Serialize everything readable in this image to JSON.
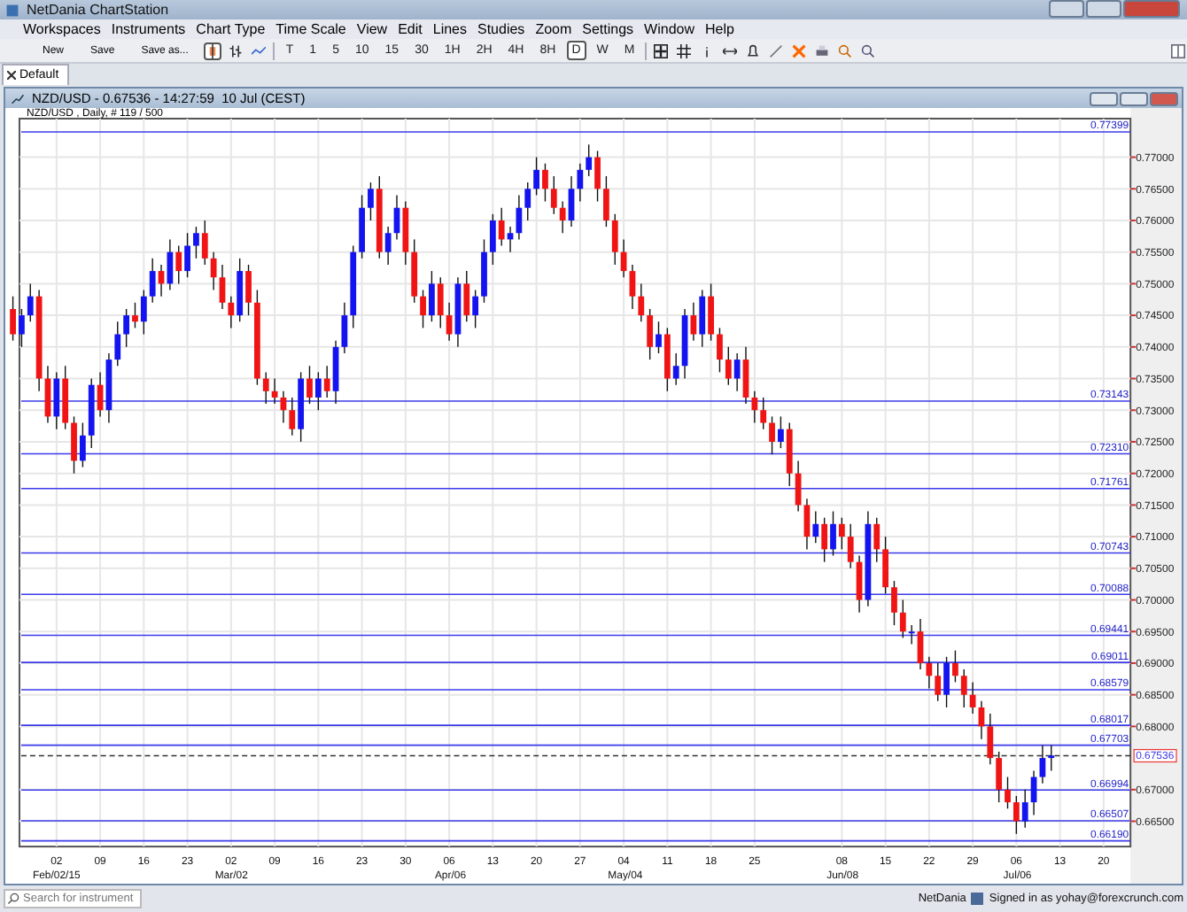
{
  "window": {
    "title": "NetDania ChartStation"
  },
  "menu": [
    "Workspaces",
    "Instruments",
    "Chart Type",
    "Time Scale",
    "View",
    "Edit",
    "Lines",
    "Studies",
    "Zoom",
    "Settings",
    "Window",
    "Help"
  ],
  "toolbar": {
    "file_buttons": [
      "New",
      "Save",
      "Save as..."
    ],
    "chart_types": [
      {
        "kind": "candle",
        "selected": true
      },
      {
        "kind": "bar",
        "selected": false
      },
      {
        "kind": "line",
        "selected": false
      }
    ],
    "timeframes": [
      {
        "label": "T",
        "selected": false
      },
      {
        "label": "1",
        "selected": false
      },
      {
        "label": "5",
        "selected": false
      },
      {
        "label": "10",
        "selected": false
      },
      {
        "label": "15",
        "selected": false
      },
      {
        "label": "30",
        "selected": false
      },
      {
        "label": "1H",
        "selected": false
      },
      {
        "label": "2H",
        "selected": false
      },
      {
        "label": "4H",
        "selected": false
      },
      {
        "label": "8H",
        "selected": false
      },
      {
        "label": "D",
        "selected": true
      },
      {
        "label": "W",
        "selected": false
      },
      {
        "label": "M",
        "selected": false
      }
    ]
  },
  "tabs": [
    {
      "label": "Default",
      "selected": true
    }
  ],
  "chart_window": {
    "title": "NZD/USD - 0.67536 - 14:27:59  10 Jul (CEST)",
    "subtitle": "NZD/USD , Daily, # 119 / 500",
    "price_lines": [
      {
        "label": "0.77399"
      },
      {
        "label": "0.73143"
      },
      {
        "label": "0.72310"
      },
      {
        "label": "0.71761"
      },
      {
        "label": "0.70743"
      },
      {
        "label": "0.70088"
      },
      {
        "label": "0.69441"
      },
      {
        "label": "0.69011"
      },
      {
        "label": "0.68579"
      },
      {
        "label": "0.68017"
      },
      {
        "label": "0.67703"
      },
      {
        "label": "0.66994"
      },
      {
        "label": "0.66507"
      },
      {
        "label": "0.66190"
      }
    ],
    "x_axis_months": [
      "Feb/02/15",
      "Mar/02",
      "Apr/06",
      "May/04",
      "Jun/08",
      "Jul/06"
    ],
    "chart_data": {
      "type": "candlestick",
      "categories": [
        null,
        null,
        null,
        null,
        null,
        "02",
        null,
        null,
        null,
        null,
        "09",
        null,
        null,
        null,
        null,
        "16",
        null,
        null,
        null,
        null,
        "23",
        null,
        null,
        null,
        null,
        "02",
        null,
        null,
        null,
        null,
        "09",
        null,
        null,
        null,
        null,
        "16",
        null,
        null,
        null,
        null,
        "23",
        null,
        null,
        null,
        null,
        "30",
        null,
        null,
        null,
        null,
        "06",
        null,
        null,
        null,
        null,
        "13",
        null,
        null,
        null,
        null,
        "20",
        null,
        null,
        null,
        null,
        "27",
        null,
        null,
        null,
        null,
        "04",
        null,
        null,
        null,
        null,
        "11",
        null,
        null,
        null,
        null,
        "18",
        null,
        null,
        null,
        null,
        "25",
        null,
        null,
        null,
        null,
        null,
        null,
        null,
        null,
        null,
        "08",
        null,
        null,
        null,
        null,
        "15",
        null,
        null,
        null,
        null,
        "22",
        null,
        null,
        null,
        null,
        "29",
        null,
        null,
        null,
        null,
        "06",
        null,
        null,
        null,
        null,
        "13",
        null,
        null,
        null,
        null,
        "20"
      ],
      "ylim": [
        0.661,
        0.7761
      ],
      "grid": true,
      "ref_lines": [
        {
          "axis": "y",
          "value": 0.67536,
          "label": "0.67536"
        }
      ],
      "ohlc": [
        [
          0.746,
          0.748,
          0.741,
          0.742
        ],
        [
          0.742,
          0.746,
          0.74,
          0.745
        ],
        [
          0.745,
          0.75,
          0.744,
          0.748
        ],
        [
          0.748,
          0.749,
          0.733,
          0.735
        ],
        [
          0.735,
          0.737,
          0.728,
          0.729
        ],
        [
          0.729,
          0.736,
          0.727,
          0.735
        ],
        [
          0.735,
          0.737,
          0.727,
          0.728
        ],
        [
          0.728,
          0.729,
          0.72,
          0.722
        ],
        [
          0.722,
          0.728,
          0.721,
          0.726
        ],
        [
          0.726,
          0.735,
          0.724,
          0.734
        ],
        [
          0.734,
          0.736,
          0.729,
          0.73
        ],
        [
          0.73,
          0.739,
          0.728,
          0.738
        ],
        [
          0.738,
          0.744,
          0.737,
          0.742
        ],
        [
          0.742,
          0.746,
          0.74,
          0.745
        ],
        [
          0.745,
          0.747,
          0.743,
          0.744
        ],
        [
          0.744,
          0.749,
          0.742,
          0.748
        ],
        [
          0.748,
          0.754,
          0.747,
          0.752
        ],
        [
          0.752,
          0.753,
          0.748,
          0.75
        ],
        [
          0.75,
          0.757,
          0.749,
          0.755
        ],
        [
          0.755,
          0.756,
          0.75,
          0.752
        ],
        [
          0.752,
          0.758,
          0.751,
          0.756
        ],
        [
          0.756,
          0.759,
          0.754,
          0.758
        ],
        [
          0.758,
          0.76,
          0.753,
          0.754
        ],
        [
          0.754,
          0.755,
          0.749,
          0.751
        ],
        [
          0.751,
          0.753,
          0.746,
          0.747
        ],
        [
          0.747,
          0.748,
          0.743,
          0.745
        ],
        [
          0.745,
          0.754,
          0.744,
          0.752
        ],
        [
          0.752,
          0.753,
          0.745,
          0.747
        ],
        [
          0.747,
          0.749,
          0.734,
          0.735
        ],
        [
          0.735,
          0.736,
          0.731,
          0.733
        ],
        [
          0.733,
          0.735,
          0.731,
          0.732
        ],
        [
          0.732,
          0.733,
          0.728,
          0.73
        ],
        [
          0.73,
          0.732,
          0.726,
          0.727
        ],
        [
          0.727,
          0.736,
          0.725,
          0.735
        ],
        [
          0.735,
          0.737,
          0.731,
          0.732
        ],
        [
          0.732,
          0.736,
          0.73,
          0.735
        ],
        [
          0.735,
          0.737,
          0.732,
          0.733
        ],
        [
          0.733,
          0.741,
          0.731,
          0.74
        ],
        [
          0.74,
          0.747,
          0.739,
          0.745
        ],
        [
          0.745,
          0.756,
          0.743,
          0.755
        ],
        [
          0.755,
          0.764,
          0.754,
          0.762
        ],
        [
          0.762,
          0.766,
          0.76,
          0.765
        ],
        [
          0.765,
          0.767,
          0.754,
          0.755
        ],
        [
          0.755,
          0.759,
          0.753,
          0.758
        ],
        [
          0.758,
          0.764,
          0.757,
          0.762
        ],
        [
          0.762,
          0.763,
          0.753,
          0.755
        ],
        [
          0.755,
          0.757,
          0.747,
          0.748
        ],
        [
          0.748,
          0.749,
          0.743,
          0.745
        ],
        [
          0.745,
          0.752,
          0.744,
          0.75
        ],
        [
          0.75,
          0.751,
          0.743,
          0.745
        ],
        [
          0.745,
          0.747,
          0.741,
          0.742
        ],
        [
          0.742,
          0.751,
          0.74,
          0.75
        ],
        [
          0.75,
          0.752,
          0.744,
          0.745
        ],
        [
          0.745,
          0.749,
          0.743,
          0.748
        ],
        [
          0.748,
          0.757,
          0.747,
          0.755
        ],
        [
          0.755,
          0.761,
          0.753,
          0.76
        ],
        [
          0.76,
          0.762,
          0.756,
          0.757
        ],
        [
          0.757,
          0.759,
          0.755,
          0.758
        ],
        [
          0.758,
          0.764,
          0.757,
          0.762
        ],
        [
          0.762,
          0.766,
          0.76,
          0.765
        ],
        [
          0.765,
          0.77,
          0.764,
          0.768
        ],
        [
          0.768,
          0.769,
          0.763,
          0.765
        ],
        [
          0.765,
          0.767,
          0.761,
          0.762
        ],
        [
          0.762,
          0.763,
          0.758,
          0.76
        ],
        [
          0.76,
          0.767,
          0.759,
          0.765
        ],
        [
          0.765,
          0.769,
          0.763,
          0.768
        ],
        [
          0.768,
          0.772,
          0.767,
          0.77
        ],
        [
          0.77,
          0.771,
          0.763,
          0.765
        ],
        [
          0.765,
          0.767,
          0.759,
          0.76
        ],
        [
          0.76,
          0.761,
          0.753,
          0.755
        ],
        [
          0.755,
          0.757,
          0.751,
          0.752
        ],
        [
          0.752,
          0.753,
          0.746,
          0.748
        ],
        [
          0.748,
          0.75,
          0.744,
          0.745
        ],
        [
          0.745,
          0.746,
          0.738,
          0.74
        ],
        [
          0.74,
          0.744,
          0.739,
          0.742
        ],
        [
          0.742,
          0.743,
          0.733,
          0.735
        ],
        [
          0.735,
          0.739,
          0.734,
          0.737
        ],
        [
          0.737,
          0.746,
          0.735,
          0.745
        ],
        [
          0.745,
          0.747,
          0.741,
          0.742
        ],
        [
          0.742,
          0.749,
          0.74,
          0.748
        ],
        [
          0.748,
          0.75,
          0.741,
          0.742
        ],
        [
          0.742,
          0.743,
          0.736,
          0.738
        ],
        [
          0.738,
          0.74,
          0.734,
          0.735
        ],
        [
          0.735,
          0.739,
          0.733,
          0.738
        ],
        [
          0.738,
          0.74,
          0.731,
          0.732
        ],
        [
          0.732,
          0.733,
          0.728,
          0.73
        ],
        [
          0.73,
          0.732,
          0.727,
          0.728
        ],
        [
          0.728,
          0.729,
          0.723,
          0.725
        ],
        [
          0.725,
          0.729,
          0.724,
          0.727
        ],
        [
          0.727,
          0.728,
          0.718,
          0.72
        ],
        [
          0.72,
          0.722,
          0.714,
          0.715
        ],
        [
          0.715,
          0.716,
          0.708,
          0.71
        ],
        [
          0.71,
          0.714,
          0.709,
          0.712
        ],
        [
          0.712,
          0.713,
          0.706,
          0.708
        ],
        [
          0.708,
          0.714,
          0.707,
          0.712
        ],
        [
          0.712,
          0.713,
          0.708,
          0.71
        ],
        [
          0.71,
          0.712,
          0.705,
          0.706
        ],
        [
          0.706,
          0.707,
          0.698,
          0.7
        ],
        [
          0.7,
          0.714,
          0.699,
          0.712
        ],
        [
          0.712,
          0.713,
          0.706,
          0.708
        ],
        [
          0.708,
          0.71,
          0.701,
          0.702
        ],
        [
          0.702,
          0.703,
          0.696,
          0.698
        ],
        [
          0.698,
          0.7,
          0.694,
          0.695
        ],
        [
          0.695,
          0.696,
          0.693,
          0.695
        ],
        [
          0.695,
          0.697,
          0.689,
          0.69
        ],
        [
          0.69,
          0.691,
          0.686,
          0.688
        ],
        [
          0.688,
          0.69,
          0.684,
          0.685
        ],
        [
          0.685,
          0.691,
          0.683,
          0.69
        ],
        [
          0.69,
          0.692,
          0.687,
          0.688
        ],
        [
          0.688,
          0.689,
          0.683,
          0.685
        ],
        [
          0.685,
          0.687,
          0.682,
          0.683
        ],
        [
          0.683,
          0.684,
          0.678,
          0.68
        ],
        [
          0.68,
          0.682,
          0.674,
          0.675
        ],
        [
          0.675,
          0.676,
          0.668,
          0.67
        ],
        [
          0.67,
          0.672,
          0.667,
          0.668
        ],
        [
          0.668,
          0.669,
          0.663,
          0.665
        ],
        [
          0.665,
          0.67,
          0.664,
          0.668
        ],
        [
          0.668,
          0.673,
          0.666,
          0.672
        ],
        [
          0.672,
          0.677,
          0.671,
          0.675
        ],
        [
          0.675,
          0.677,
          0.673,
          0.6754
        ],
        null,
        null,
        null,
        null,
        null,
        null
      ],
      "yticks": [
        {
          "value": 0.77,
          "label": "0.77000"
        },
        {
          "value": 0.765,
          "label": "0.76500"
        },
        {
          "value": 0.76,
          "label": "0.76000"
        },
        {
          "value": 0.755,
          "label": "0.75500"
        },
        {
          "value": 0.75,
          "label": "0.75000"
        },
        {
          "value": 0.745,
          "label": "0.74500"
        },
        {
          "value": 0.74,
          "label": "0.74000"
        },
        {
          "value": 0.735,
          "label": "0.73500"
        },
        {
          "value": 0.73,
          "label": "0.73000"
        },
        {
          "value": 0.725,
          "label": "0.72500"
        },
        {
          "value": 0.72,
          "label": "0.72000"
        },
        {
          "value": 0.715,
          "label": "0.71500"
        },
        {
          "value": 0.71,
          "label": "0.71000"
        },
        {
          "value": 0.705,
          "label": "0.70500"
        },
        {
          "value": 0.7,
          "label": "0.70000"
        },
        {
          "value": 0.695,
          "label": "0.69500"
        },
        {
          "value": 0.69,
          "label": "0.69000"
        },
        {
          "value": 0.685,
          "label": "0.68500"
        },
        {
          "value": 0.68,
          "label": "0.68000"
        },
        {
          "value": 0.67,
          "label": "0.67000"
        },
        {
          "value": 0.665,
          "label": "0.66500"
        }
      ]
    }
  },
  "status_bar": {
    "search_placeholder": "Search for instrument",
    "brand": "NetDania",
    "signed_in": "Signed in as yohay@forexcrunch.com"
  }
}
